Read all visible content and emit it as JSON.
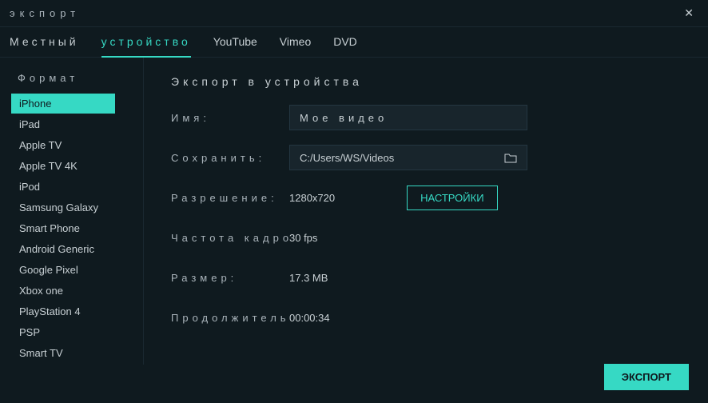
{
  "window": {
    "title": "экспорт"
  },
  "tabs": {
    "local": "Местный",
    "device": "устройство",
    "youtube": "YouTube",
    "vimeo": "Vimeo",
    "dvd": "DVD"
  },
  "sidebar": {
    "title": "Формат",
    "items": [
      "iPhone",
      "iPad",
      "Apple TV",
      "Apple TV 4K",
      "iPod",
      "Samsung Galaxy",
      "Smart Phone",
      "Android Generic",
      "Google Pixel",
      "Xbox one",
      "PlayStation 4",
      "PSP",
      "Smart TV"
    ]
  },
  "main": {
    "title": "Экспорт в устройства",
    "name_label": "Имя:",
    "name_value": "Мое видео",
    "save_label": "Сохранить:",
    "save_value": "C:/Users/WS/Videos",
    "resolution_label": "Разрешение:",
    "resolution_value": "1280x720",
    "framerate_label": "Частота кадров:",
    "framerate_value": "30 fps",
    "size_label": "Размер:",
    "size_value": "17.3 MB",
    "duration_label": "Продолжительность:",
    "duration_value": "00:00:34",
    "settings_btn": "НАСТРОЙКИ",
    "export_btn": "ЭКСПОРТ"
  }
}
